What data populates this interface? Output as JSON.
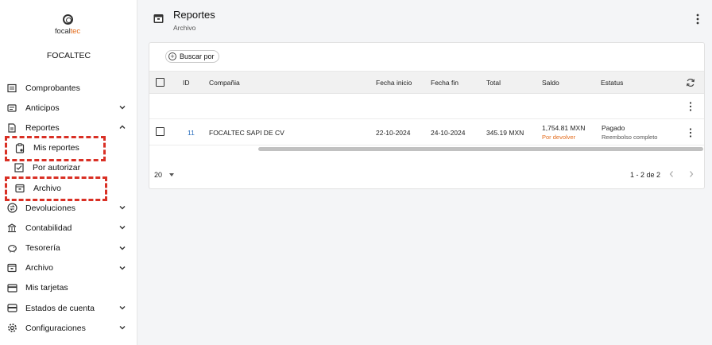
{
  "brand": {
    "logo_prefix": "focal",
    "logo_suffix": "tec",
    "company": "FOCALTEC",
    "accent": "#e36c1d"
  },
  "sidebar": {
    "items": [
      {
        "label": "Comprobantes",
        "icon": "receipt-icon",
        "chevron": "none"
      },
      {
        "label": "Anticipos",
        "icon": "wallet-icon",
        "chevron": "down"
      },
      {
        "label": "Reportes",
        "icon": "report-icon",
        "chevron": "up"
      },
      {
        "label": "Mis reportes",
        "icon": "clipboard-icon",
        "chevron": "none",
        "sub": true
      },
      {
        "label": "Por autorizar",
        "icon": "checkbox-icon",
        "chevron": "none",
        "sub": true
      },
      {
        "label": "Archivo",
        "icon": "archive-icon",
        "chevron": "none",
        "sub": true
      },
      {
        "label": "Devoluciones",
        "icon": "swap-icon",
        "chevron": "down"
      },
      {
        "label": "Contabilidad",
        "icon": "bank-icon",
        "chevron": "down"
      },
      {
        "label": "Tesorería",
        "icon": "piggy-bank-icon",
        "chevron": "down"
      },
      {
        "label": "Archivo",
        "icon": "archive-icon",
        "chevron": "down"
      },
      {
        "label": "Mis tarjetas",
        "icon": "card-icon",
        "chevron": "none"
      },
      {
        "label": "Estados de cuenta",
        "icon": "statement-icon",
        "chevron": "down"
      },
      {
        "label": "Configuraciones",
        "icon": "gear-icon",
        "chevron": "down"
      }
    ]
  },
  "header": {
    "title": "Reportes",
    "subtitle": "Archivo"
  },
  "toolbar": {
    "search_label": "Buscar por"
  },
  "table": {
    "columns": [
      "ID",
      "Compañia",
      "Fecha inicio",
      "Fecha fin",
      "Total",
      "Saldo",
      "Estatus"
    ],
    "rows": [
      {
        "id": "11",
        "company": "FOCALTEC SAPI DE CV",
        "start": "22-10-2024",
        "end": "24-10-2024",
        "total": "345.19 MXN",
        "balance": "1,754.81 MXN",
        "balance_note": "Por devolver",
        "status": "Pagado",
        "status_note": "Reembolso completo"
      }
    ]
  },
  "footer": {
    "page_size": "20",
    "range": "1 - 2 de 2"
  }
}
